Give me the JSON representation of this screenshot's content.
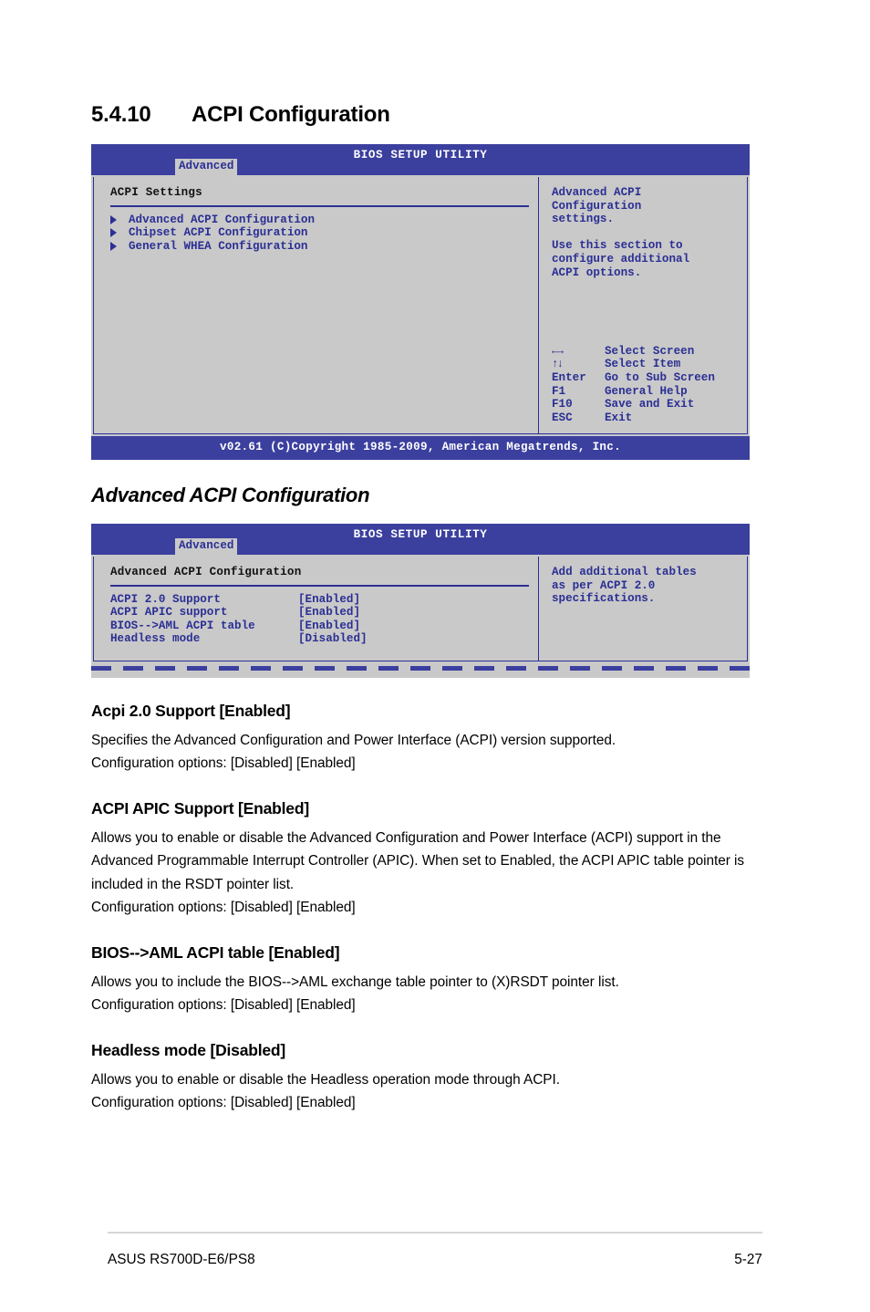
{
  "section": {
    "number": "5.4.10",
    "title": "ACPI Configuration"
  },
  "bios_screen_1": {
    "title": "BIOS SETUP UTILITY",
    "tab": "Advanced",
    "panel_heading": "ACPI Settings",
    "menu_items": [
      "Advanced ACPI Configuration",
      "Chipset ACPI Configuration",
      "General WHEA Configuration"
    ],
    "help_text_1": "Advanced ACPI\nConfiguration\nsettings.",
    "help_text_2": "Use this section to\nconfigure additional\nACPI options.",
    "keys": [
      {
        "key": "←→",
        "desc": "Select Screen"
      },
      {
        "key": "↑↓",
        "desc": "Select Item"
      },
      {
        "key": "Enter",
        "desc": "Go to Sub Screen"
      },
      {
        "key": "F1",
        "desc": "General Help"
      },
      {
        "key": "F10",
        "desc": "Save and Exit"
      },
      {
        "key": "ESC",
        "desc": "Exit"
      }
    ],
    "footer": "v02.61 (C)Copyright 1985-2009, American Megatrends, Inc."
  },
  "subsection": {
    "title": "Advanced ACPI Configuration"
  },
  "bios_screen_2": {
    "title": "BIOS SETUP UTILITY",
    "tab": "Advanced",
    "panel_heading": "Advanced ACPI Configuration",
    "settings": [
      {
        "name": "ACPI 2.0 Support",
        "value": "[Enabled]"
      },
      {
        "name": "ACPI APIC support",
        "value": "[Enabled]"
      },
      {
        "name": "BIOS-->AML ACPI table",
        "value": "[Enabled]"
      },
      {
        "name": "Headless mode",
        "value": "[Disabled]"
      }
    ],
    "help_text": "Add additional tables\nas per ACPI 2.0\nspecifications."
  },
  "options": [
    {
      "title": "Acpi 2.0 Support [Enabled]",
      "body": "Specifies the Advanced Configuration and Power Interface (ACPI) version supported.\nConfiguration options: [Disabled] [Enabled]"
    },
    {
      "title": "ACPI APIC Support [Enabled]",
      "body": "Allows you to enable or disable the Advanced Configuration and Power Interface (ACPI) support in the Advanced Programmable Interrupt Controller (APIC). When set to Enabled, the ACPI APIC table pointer is included in the RSDT pointer list.\nConfiguration options: [Disabled] [Enabled]"
    },
    {
      "title": "BIOS-->AML ACPI table [Enabled]",
      "body": "Allows you to include the BIOS-->AML exchange table pointer to (X)RSDT pointer list.\nConfiguration options: [Disabled] [Enabled]"
    },
    {
      "title": "Headless mode [Disabled]",
      "body": "Allows you to enable or disable the Headless operation mode through ACPI.\nConfiguration options: [Disabled] [Enabled]"
    }
  ],
  "page_footer": {
    "product": "ASUS RS700D-E6/PS8",
    "page_number": "5-27"
  },
  "colors": {
    "bios_blue": "#3b3f9e",
    "bios_text_blue": "#2b2f94",
    "bios_bg": "#c9c9c9"
  }
}
